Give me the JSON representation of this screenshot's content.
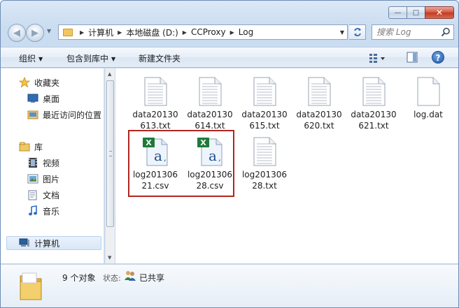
{
  "window": {
    "caption": {
      "minimize": "—",
      "maximize": "□",
      "close": "✕"
    }
  },
  "nav": {
    "back": "◀",
    "forward": "▶",
    "breadcrumb": [
      "计算机",
      "本地磁盘 (D:)",
      "CCProxy",
      "Log"
    ],
    "search_placeholder": "搜索 Log"
  },
  "commands": {
    "organize": "组织",
    "include_in_library": "包含到库中",
    "new_folder": "新建文件夹",
    "help": "?"
  },
  "sidebar": {
    "favorites": "收藏夹",
    "desktop": "桌面",
    "recent": "最近访问的位置",
    "libraries": "库",
    "videos": "视频",
    "pictures": "图片",
    "documents": "文档",
    "music": "音乐",
    "computer": "计算机"
  },
  "files": [
    {
      "line1": "data20130",
      "line2": "613.txt",
      "type": "txt"
    },
    {
      "line1": "data20130",
      "line2": "614.txt",
      "type": "txt"
    },
    {
      "line1": "data20130",
      "line2": "615.txt",
      "type": "txt"
    },
    {
      "line1": "data20130",
      "line2": "620.txt",
      "type": "txt"
    },
    {
      "line1": "data20130",
      "line2": "621.txt",
      "type": "txt"
    },
    {
      "line1": "log.dat",
      "line2": "",
      "type": "dat"
    },
    {
      "line1": "log201306",
      "line2": "21.csv",
      "type": "csv"
    },
    {
      "line1": "log201306",
      "line2": "28.csv",
      "type": "csv"
    },
    {
      "line1": "log201306",
      "line2": "28.txt",
      "type": "txt"
    }
  ],
  "details": {
    "count": "9 个对象",
    "state_label": "状态:",
    "state_value": "已共享"
  },
  "colors": {
    "highlight": "#b0261f",
    "excel_green": "#1f7a3a",
    "accent_blue": "#2e65a8"
  }
}
